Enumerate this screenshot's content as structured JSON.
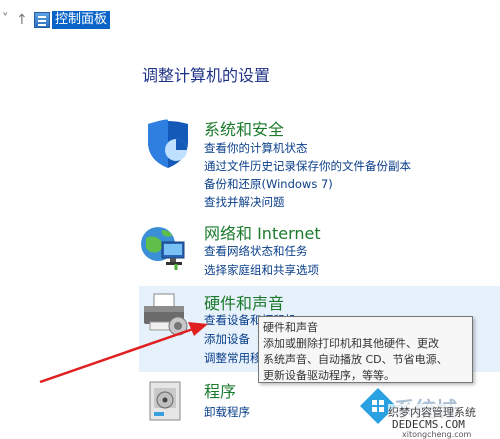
{
  "address": {
    "text": "控制面板",
    "up_symbol": "↑",
    "dropdown_symbol": "˅"
  },
  "page_title": "调整计算机的设置",
  "categories": [
    {
      "title": "系统和安全",
      "icon": "shield-icon",
      "links": [
        "查看你的计算机状态",
        "通过文件历史记录保存你的文件备份副本",
        "备份和还原(Windows 7)",
        "查找并解决问题"
      ]
    },
    {
      "title": "网络和 Internet",
      "icon": "network-globe-icon",
      "links": [
        "查看网络状态和任务",
        "选择家庭组和共享选项"
      ]
    },
    {
      "title": "硬件和声音",
      "icon": "printer-speaker-icon",
      "links": [
        "查看设备和打印机",
        "添加设备",
        "调整常用移"
      ]
    },
    {
      "title": "程序",
      "icon": "programs-icon",
      "links": [
        "卸载程序"
      ]
    }
  ],
  "tooltip": {
    "title": "硬件和声音",
    "lines": [
      "添加或删除打印机和其他硬件、更改",
      "系统声音、自动播放 CD、节省电源、",
      "更新设备驱动程序，等等。"
    ]
  },
  "watermark": {
    "brand": "系统城",
    "line1": "织梦内容管理系统",
    "line2": "DEDECMS.COM",
    "line3": "xitongcheng.com"
  },
  "colors": {
    "category_title": "#1b7a2c",
    "link": "#0a3f8a",
    "page_title": "#1e3287",
    "hover_background": "#e7f1fb",
    "address_highlight": "#0a64c8",
    "arrow": "#e02020"
  }
}
